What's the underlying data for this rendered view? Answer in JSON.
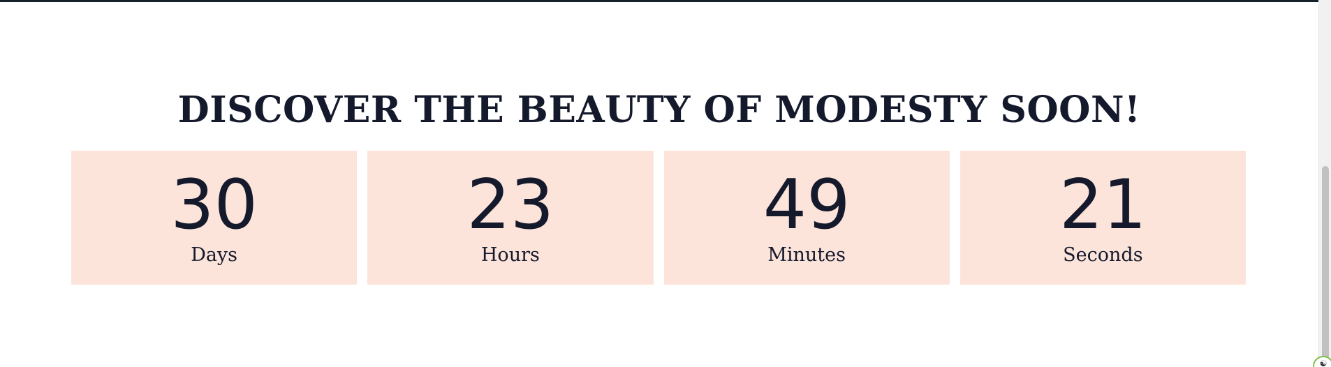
{
  "headline": "DISCOVER THE BEAUTY OF MODESTY SOON!",
  "countdown": {
    "days": {
      "value": "30",
      "label": "Days"
    },
    "hours": {
      "value": "23",
      "label": "Hours"
    },
    "minutes": {
      "value": "49",
      "label": "Minutes"
    },
    "seconds": {
      "value": "21",
      "label": "Seconds"
    }
  },
  "colors": {
    "cell_background": "#fde4db",
    "text": "#141a2c",
    "top_rule": "#16222a",
    "widget_border": "#7cc043"
  },
  "icons": {
    "floating_widget": "accessibility-icon"
  }
}
